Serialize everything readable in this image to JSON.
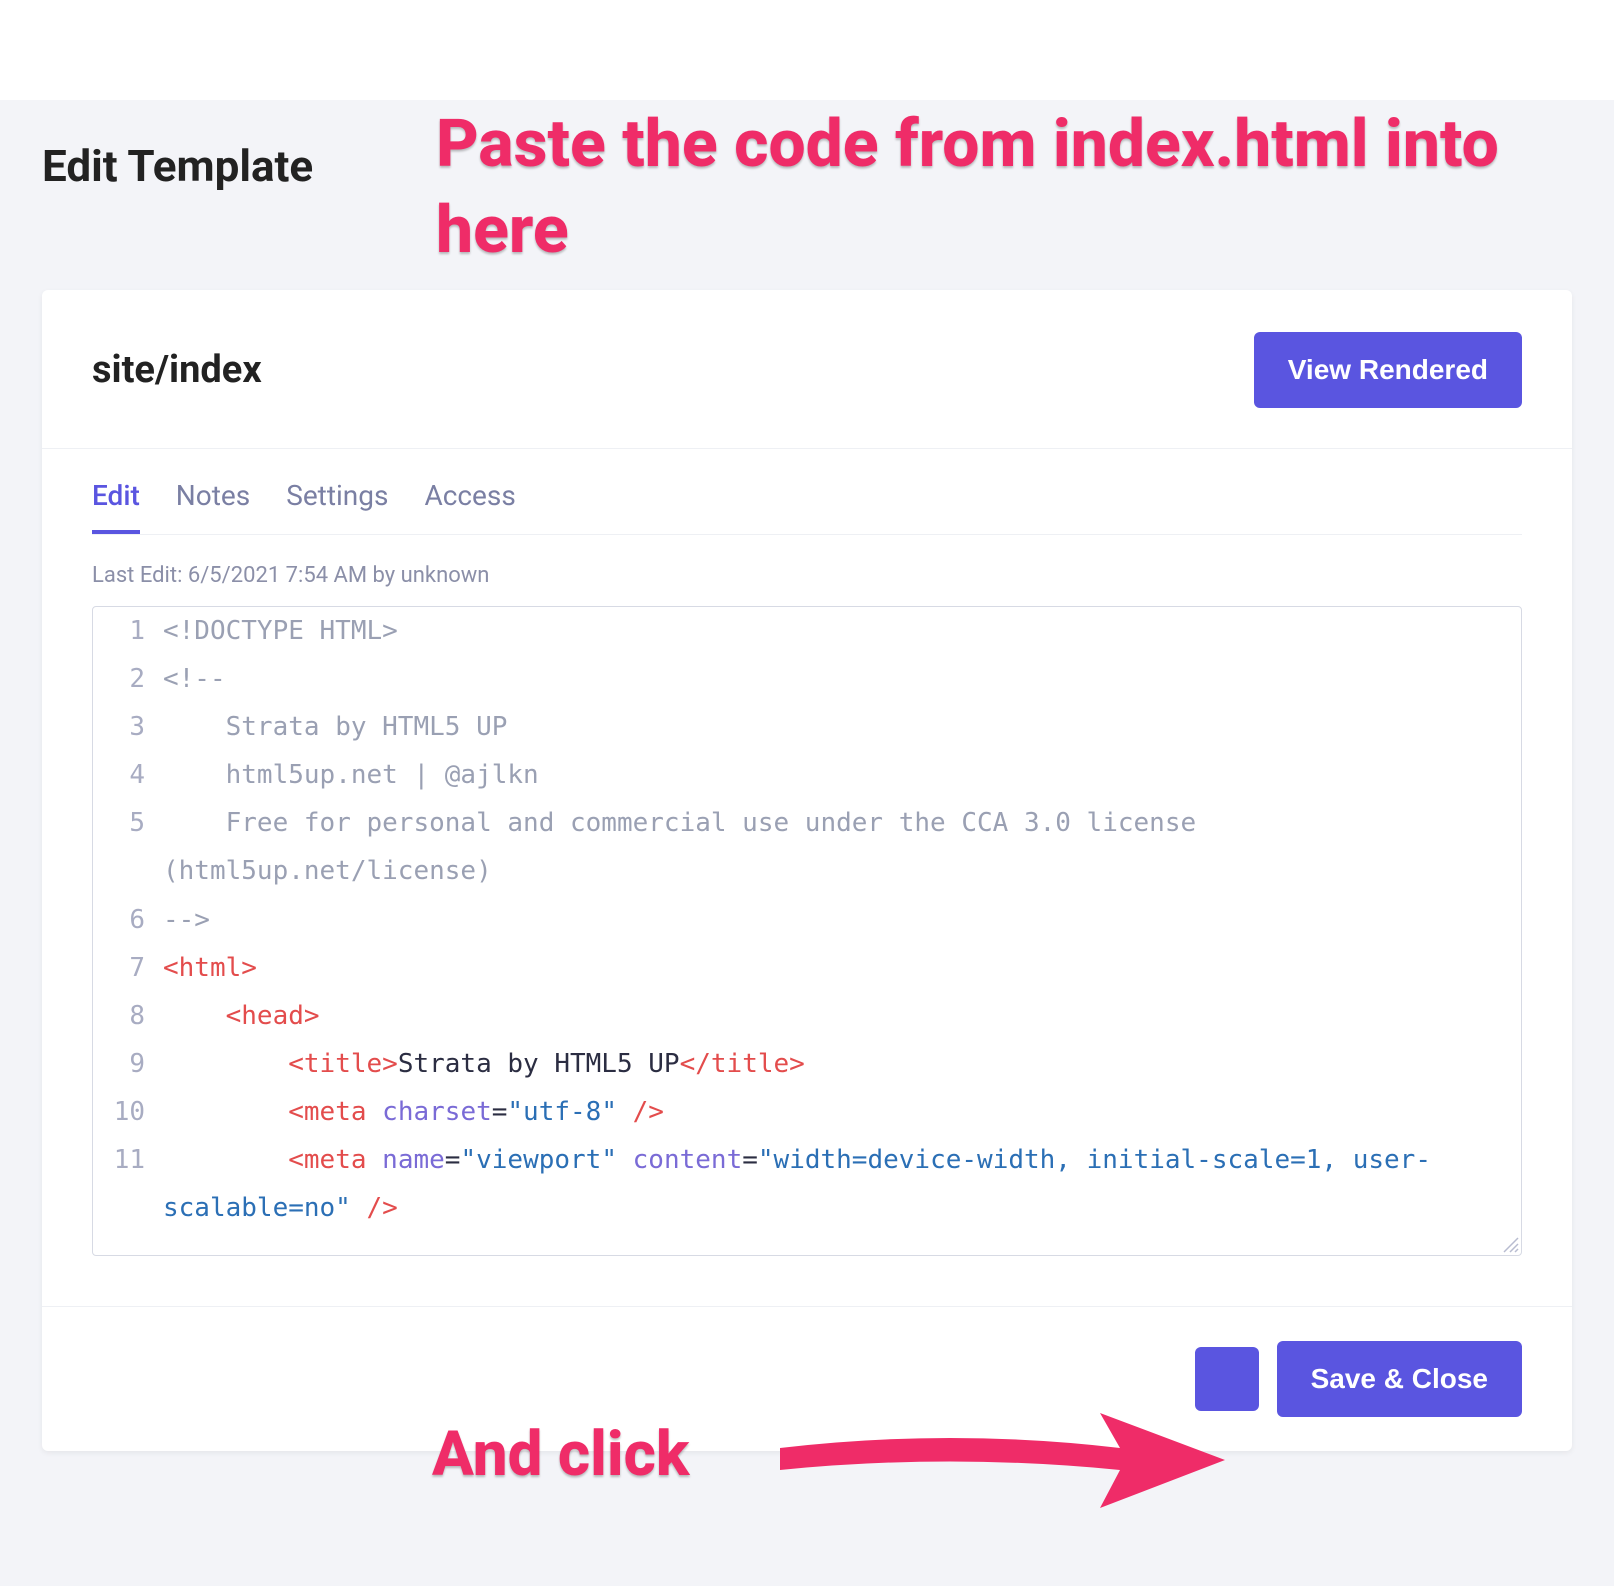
{
  "page": {
    "title": "Edit Template"
  },
  "header": {
    "template_name": "site/index",
    "view_rendered_label": "View Rendered"
  },
  "tabs": [
    {
      "label": "Edit",
      "active": true
    },
    {
      "label": "Notes",
      "active": false
    },
    {
      "label": "Settings",
      "active": false
    },
    {
      "label": "Access",
      "active": false
    }
  ],
  "last_edit": "Last Edit: 6/5/2021 7:54 AM by unknown",
  "code": {
    "lines": [
      {
        "n": 1,
        "segments": [
          {
            "t": "<!DOCTYPE HTML>",
            "cls": "tok-comment"
          }
        ]
      },
      {
        "n": 2,
        "segments": [
          {
            "t": "<!--",
            "cls": "tok-comment"
          }
        ]
      },
      {
        "n": 3,
        "segments": [
          {
            "t": "    Strata by HTML5 UP",
            "cls": "tok-comment"
          }
        ]
      },
      {
        "n": 4,
        "segments": [
          {
            "t": "    html5up.net | @ajlkn",
            "cls": "tok-comment"
          }
        ]
      },
      {
        "n": 5,
        "segments": [
          {
            "t": "    Free for personal and commercial use under the CCA 3.0 license (html5up.net/license)",
            "cls": "tok-comment"
          }
        ]
      },
      {
        "n": 6,
        "segments": [
          {
            "t": "-->",
            "cls": "tok-comment"
          }
        ]
      },
      {
        "n": 7,
        "segments": [
          {
            "t": "<html>",
            "cls": "tok-tag"
          }
        ]
      },
      {
        "n": 8,
        "segments": [
          {
            "t": "    ",
            "cls": ""
          },
          {
            "t": "<head>",
            "cls": "tok-tag"
          }
        ]
      },
      {
        "n": 9,
        "segments": [
          {
            "t": "        ",
            "cls": ""
          },
          {
            "t": "<title>",
            "cls": "tok-tag"
          },
          {
            "t": "Strata by HTML5 UP",
            "cls": "tok-text"
          },
          {
            "t": "</title>",
            "cls": "tok-tag"
          }
        ]
      },
      {
        "n": 10,
        "segments": [
          {
            "t": "        ",
            "cls": ""
          },
          {
            "t": "<meta",
            "cls": "tok-tag"
          },
          {
            "t": " ",
            "cls": ""
          },
          {
            "t": "charset",
            "cls": "tok-attr"
          },
          {
            "t": "=",
            "cls": "tok-attr-eq"
          },
          {
            "t": "\"utf-8\"",
            "cls": "tok-string"
          },
          {
            "t": " />",
            "cls": "tok-tag"
          }
        ]
      },
      {
        "n": 11,
        "segments": [
          {
            "t": "        ",
            "cls": ""
          },
          {
            "t": "<meta",
            "cls": "tok-tag"
          },
          {
            "t": " ",
            "cls": ""
          },
          {
            "t": "name",
            "cls": "tok-attr"
          },
          {
            "t": "=",
            "cls": "tok-attr-eq"
          },
          {
            "t": "\"viewport\"",
            "cls": "tok-string"
          },
          {
            "t": " ",
            "cls": ""
          },
          {
            "t": "content",
            "cls": "tok-attr"
          },
          {
            "t": "=",
            "cls": "tok-attr-eq"
          },
          {
            "t": "\"width=device-width, initial-scale=1, user-scalable=no\"",
            "cls": "tok-string"
          },
          {
            "t": " />",
            "cls": "tok-tag"
          }
        ]
      }
    ]
  },
  "footer": {
    "save_close_label": "Save & Close"
  },
  "annotations": {
    "paste_instruction": "Paste the code from index.html into here",
    "click_instruction": "And click"
  },
  "colors": {
    "primary": "#5a55e0",
    "annotation": "#ef2c68"
  }
}
